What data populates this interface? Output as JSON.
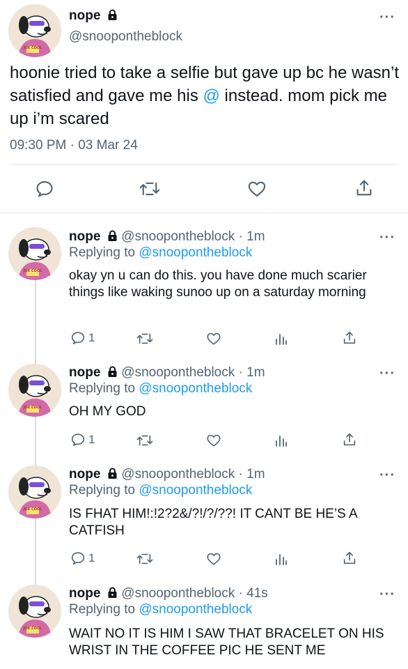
{
  "main_tweet": {
    "name": "nope",
    "handle": "@snoopontheblock",
    "text_before": "hoonie tried to take a selfie but gave up bc he wasn’t satisfied and gave me his ",
    "mention": "@",
    "text_after": " instead. mom pick me up i’m scared",
    "timestamp": "09:30 PM · 03 Mar 24"
  },
  "replies": [
    {
      "name": "nope",
      "handle_time": "@snoopontheblock · 1m",
      "replying_prefix": "Replying to ",
      "replying_to": "@snoopontheblock",
      "text": "okay yn u can do this. you have done much scarier things like waking sunoo up on a saturday morning",
      "reply_count": "1"
    },
    {
      "name": "nope",
      "handle_time": "@snoopontheblock · 1m",
      "replying_prefix": "Replying to ",
      "replying_to": "@snoopontheblock",
      "text": "OH MY GOD",
      "reply_count": "1"
    },
    {
      "name": "nope",
      "handle_time": "@snoopontheblock · 1m",
      "replying_prefix": "Replying to ",
      "replying_to": "@snoopontheblock",
      "text": "IS FHAT HIM!:!2?2&/?!/?/??! IT CANT BE HE’S A CATFISH",
      "reply_count": "1"
    },
    {
      "name": "nope",
      "handle_time": "@snoopontheblock · 41s",
      "replying_prefix": "Replying to ",
      "replying_to": "@snoopontheblock",
      "text": "WAIT NO IT IS HIM I SAW THAT BRACELET ON HIS WRIST IN THE COFFEE PIC HE SENT ME"
    }
  ],
  "avatar_text": "JOE COOL",
  "colors": {
    "accent": "#1d9bf0",
    "muted": "#536471",
    "text": "#0f1419",
    "divider": "#e1e6ea"
  },
  "icons": [
    "lock-icon",
    "more-icon",
    "reply-icon",
    "retweet-icon",
    "like-icon",
    "views-icon",
    "share-icon"
  ]
}
